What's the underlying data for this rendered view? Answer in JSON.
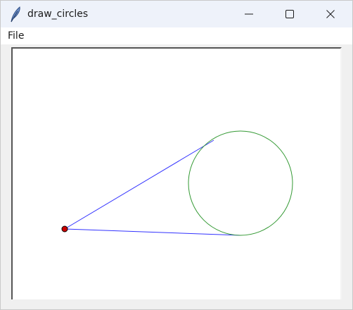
{
  "window": {
    "title": "draw_circles",
    "app_icon": "feather-icon",
    "controls": [
      "minimize-icon",
      "maximize-icon",
      "close-icon"
    ]
  },
  "menubar": {
    "items": [
      {
        "label": "File"
      }
    ]
  },
  "canvas": {
    "background": "#ffffff",
    "point_color": "#cc0000",
    "tangent_line_color": "#3333ff",
    "circle_color": "#339933"
  }
}
